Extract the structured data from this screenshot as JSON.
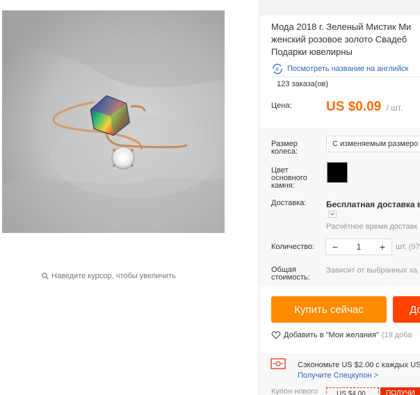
{
  "product": {
    "title_lines": [
      "Мода 2018 г. Зеленый Мистик Ми",
      "женский розовое золото Свадеб",
      "Подарки ювелирны"
    ],
    "translate_link": "Посмотреть название на английск",
    "orders": "123 заказа(ов)",
    "zoom_hint": "Наведите курсор, чтобы увеличить"
  },
  "price": {
    "label": "Цена:",
    "value": "US $0.09",
    "unit": "/ шт."
  },
  "options": {
    "size_label": "Размер колеса:",
    "size_value": "С изменяемым размеро",
    "stone_color_label": "Цвет основного камня:",
    "stone_color_value": "#000000",
    "delivery_label": "Доставка:",
    "delivery_value": "Бесплатная доставка в I",
    "delivery_eta": "Расчётное время доставк",
    "quantity_label": "Количество:",
    "quantity_value": "1",
    "quantity_unit": "шт. (97",
    "total_label": "Общая стоимость:",
    "total_note": "Зависит от выбранных ха"
  },
  "actions": {
    "buy_now": "Купить сейчас",
    "add_to_cart": "До",
    "wishlist": "Добавить в \"Мои желания\"",
    "wishlist_count": "(19 доба"
  },
  "coupons": {
    "save_text": "Сэкономьте US $2.00 с каждых US",
    "get_coupon_link": "Получите Спецкупон >",
    "new_coupon_label": "Купон нового",
    "new_coupon_card": "US $4.00",
    "new_coupon_get": "ПОЛУЧИ"
  },
  "colors": {
    "price_orange": "#ff6a00",
    "buy_now_orange": "#ff8a00",
    "cart_red": "#ff4200",
    "link_blue": "#2a64c5"
  }
}
